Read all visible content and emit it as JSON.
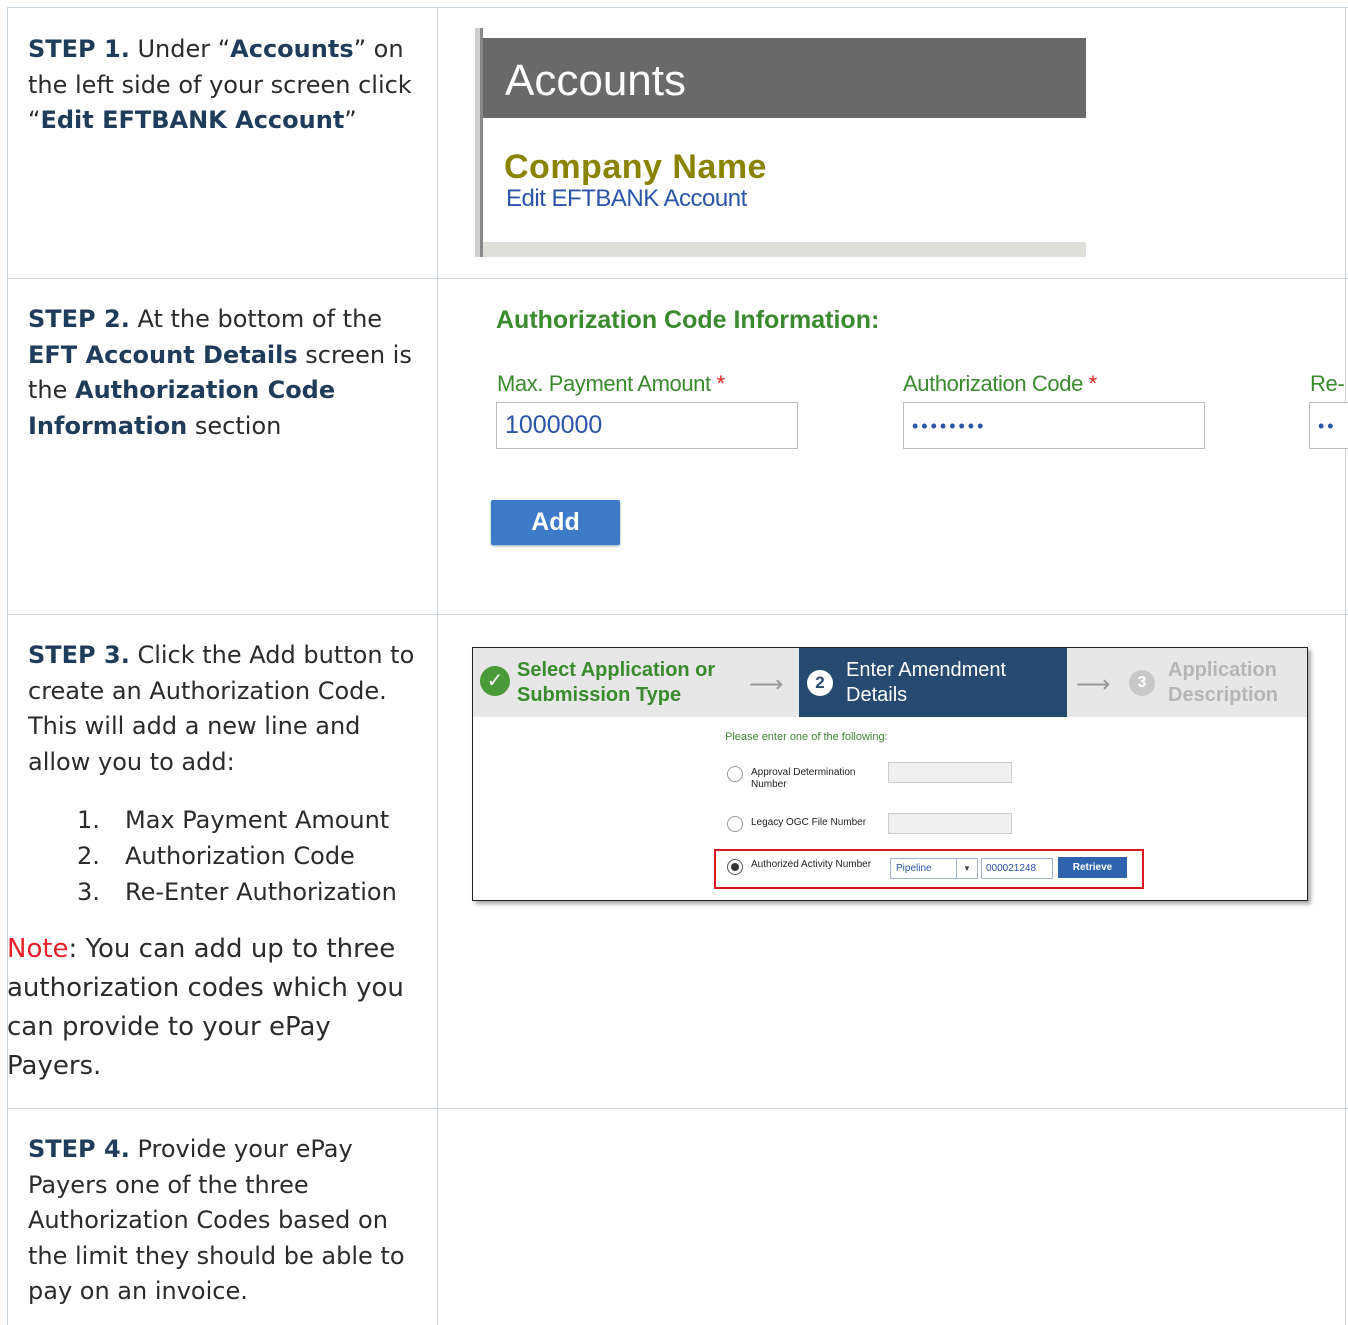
{
  "step1": {
    "label": "STEP 1.",
    "text1": " Under “",
    "bold1": "Accounts",
    "text2": "” on the left side of your screen click “",
    "bold2": "Edit EFTBANK Account",
    "text3": "”",
    "image": {
      "header": "Accounts",
      "company": "Company Name",
      "link": "Edit EFTBANK Account"
    }
  },
  "step2": {
    "label": "STEP 2.",
    "text1": " At the bottom of the ",
    "bold1": "EFT Account Details",
    "text2": " screen is the ",
    "bold2": "Authorization Code Information",
    "text3": " section",
    "image": {
      "section_title": "Authorization Code Information:",
      "max_label": "Max. Payment Amount",
      "auth_label": "Authorization Code",
      "reenter_label": "Re-",
      "required_mark": "*",
      "max_value": "1000000",
      "auth_value": "••••••••",
      "reenter_value": "••",
      "add_button": "Add"
    }
  },
  "step3": {
    "label": "STEP 3.",
    "text": " Click the Add button to create an Authorization Code. This will add a new line and allow you to add:",
    "list": [
      {
        "num": "1.",
        "text": "Max Payment Amount"
      },
      {
        "num": "2.",
        "text": "Authorization Code"
      },
      {
        "num": "3.",
        "text": "Re-Enter Authorization"
      }
    ],
    "note_label": "Note",
    "note_text": ":  You can add up to three authorization codes which you can provide to your ePay Payers.",
    "image": {
      "wizard_step1": "Select Application or Submission Type",
      "wizard_step2_num": "2",
      "wizard_step2": "Enter Amendment Details",
      "wizard_step3_num": "3",
      "wizard_step3": "Application Description",
      "check": "✓",
      "arrow": "⟶",
      "prompt": "Please enter one of the following:",
      "opt1": "Approval Determination Number",
      "opt2": "Legacy OGC File Number",
      "opt3": "Authorized Activity Number",
      "select_value": "Pipeline",
      "caret": "▼",
      "number_value": "000021248",
      "retrieve": "Retrieve"
    }
  },
  "step4": {
    "label": "STEP 4.",
    "text": " Provide your ePay Payers one of the three Authorization Codes based on the limit they should be able to pay on an invoice."
  }
}
